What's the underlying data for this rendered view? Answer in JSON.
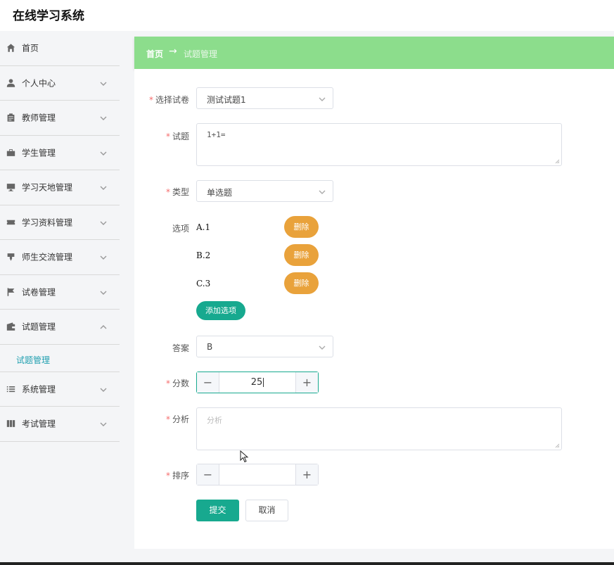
{
  "app": {
    "title": "在线学习系统"
  },
  "sidebar": {
    "items": [
      {
        "label": "首页",
        "icon": "home-icon",
        "expandable": false
      },
      {
        "label": "个人中心",
        "icon": "user-icon",
        "expandable": true
      },
      {
        "label": "教师管理",
        "icon": "clipboard-icon",
        "expandable": true
      },
      {
        "label": "学生管理",
        "icon": "briefcase-icon",
        "expandable": true
      },
      {
        "label": "学习天地管理",
        "icon": "monitor-icon",
        "expandable": true
      },
      {
        "label": "学习资料管理",
        "icon": "ticket-icon",
        "expandable": true
      },
      {
        "label": "师生交流管理",
        "icon": "pin-icon",
        "expandable": true
      },
      {
        "label": "试卷管理",
        "icon": "flag-icon",
        "expandable": true
      },
      {
        "label": "试题管理",
        "icon": "wallet-icon",
        "expandable": true,
        "expanded": true
      },
      {
        "label": "系统管理",
        "icon": "list-icon",
        "expandable": true
      },
      {
        "label": "考试管理",
        "icon": "book-icon",
        "expandable": true
      }
    ],
    "sub_active": "试题管理"
  },
  "breadcrumb": {
    "home": "首页",
    "separator": "→",
    "current": "试题管理"
  },
  "form": {
    "paper": {
      "label": "选择试卷",
      "value": "测试试题1"
    },
    "question": {
      "label": "试题",
      "value": "1+1="
    },
    "type": {
      "label": "类型",
      "value": "单选题"
    },
    "options": {
      "label": "选项",
      "items": [
        "A.1",
        "B.2",
        "C.3"
      ],
      "delete_label": "删除",
      "add_label": "添加选项"
    },
    "answer": {
      "label": "答案",
      "value": "B"
    },
    "score": {
      "label": "分数",
      "value": "25"
    },
    "analysis": {
      "label": "分析",
      "placeholder": "分析"
    },
    "order": {
      "label": "排序",
      "value": ""
    },
    "stepper_minus": "−",
    "stepper_plus": "+",
    "submit_label": "提交",
    "cancel_label": "取消"
  },
  "colors": {
    "accent": "#17a98f",
    "breadcrumb_bg": "#8cdd8c",
    "delete_button": "#e9a23b",
    "required": "#f56c6c",
    "active_sub": "#22a0b0"
  }
}
